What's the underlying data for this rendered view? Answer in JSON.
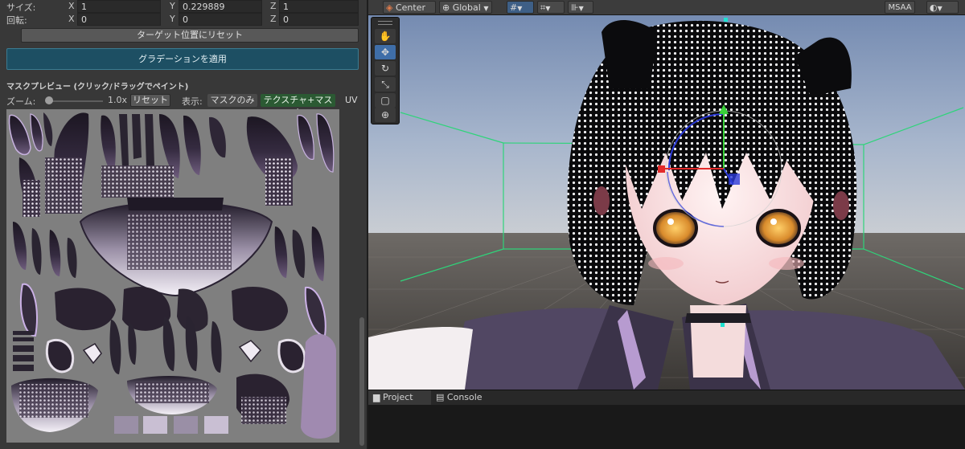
{
  "inspector": {
    "size_label": "サイズ:",
    "rotation_label": "回転:",
    "size": {
      "x_label": "X",
      "x": "1",
      "y_label": "Y",
      "y": "0.229889",
      "z_label": "Z",
      "z": "1"
    },
    "rotation": {
      "x_label": "X",
      "x": "0",
      "y_label": "Y",
      "y": "0",
      "z_label": "Z",
      "z": "0"
    },
    "reset_target_label": "ターゲット位置にリセット",
    "apply_gradation_label": "グラデーションを適用",
    "mask_preview_title": "マスクプレビュー (クリック/ドラッグでペイント)",
    "zoom_label": "ズーム:",
    "zoom_value": "1.0x",
    "zoom_slider_fraction": 0.0,
    "reset_label": "リセット",
    "display_label": "表示:",
    "mask_only_label": "マスクのみ",
    "texture_mask_label": "テクスチャ+マスク",
    "uv_label": "UV"
  },
  "scene": {
    "pivot_mode": "Center",
    "space_mode": "Global",
    "msaa_label": "MSAA",
    "tools": [
      "hand-tool",
      "move-tool",
      "rotate-tool",
      "scale-tool",
      "rect-tool",
      "transform-tool"
    ]
  },
  "bottom": {
    "tabs": [
      {
        "label": "Project"
      },
      {
        "label": "Console"
      }
    ]
  },
  "colors": {
    "apply_button": "#1d4f63",
    "active_display": "#2b5a33",
    "scene_sky": "#8fa3c4",
    "grid_floor": "#4a4a4a",
    "bounds_green": "#2fd47a"
  }
}
